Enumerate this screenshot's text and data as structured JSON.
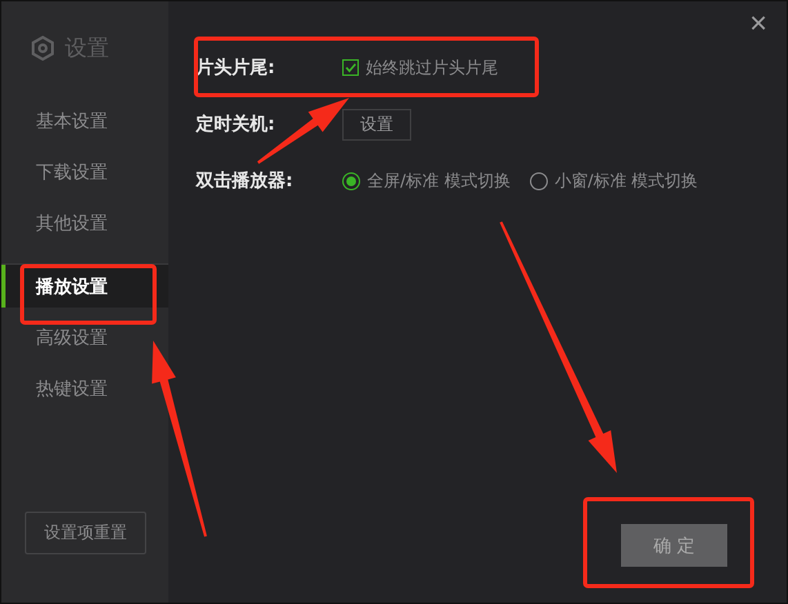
{
  "sidebar": {
    "title": "设置",
    "items": [
      {
        "label": "基本设置",
        "selected": false
      },
      {
        "label": "下载设置",
        "selected": false
      },
      {
        "label": "其他设置",
        "selected": false
      },
      {
        "label": "播放设置",
        "selected": true
      },
      {
        "label": "高级设置",
        "selected": false
      },
      {
        "label": "热键设置",
        "selected": false
      }
    ],
    "reset_button": "设置项重置"
  },
  "close": "×",
  "settings": [
    {
      "kind": "checkbox",
      "label": "片头片尾:",
      "option": {
        "label": "始终跳过片头片尾",
        "checked": true
      }
    },
    {
      "kind": "button",
      "label": "定时关机:",
      "button": "设置"
    },
    {
      "kind": "radio",
      "label": "双击播放器:",
      "options": [
        {
          "label": "全屏/标准 模式切换",
          "selected": true
        },
        {
          "label": "小窗/标准 模式切换",
          "selected": false
        }
      ]
    }
  ],
  "confirm_button": "确 定"
}
